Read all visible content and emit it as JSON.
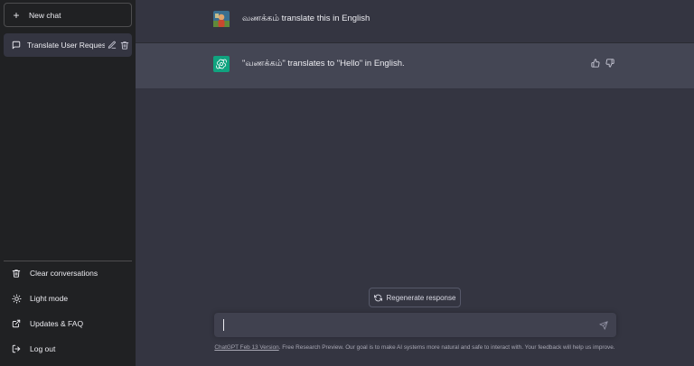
{
  "sidebar": {
    "new_chat": {
      "icon": "plus-icon",
      "label": "New chat"
    },
    "conversations": [
      {
        "title": "Translate User Request.",
        "icon": "chat-icon"
      }
    ],
    "links": [
      {
        "label": "Clear conversations",
        "icon": "trash-icon"
      },
      {
        "label": "Light mode",
        "icon": "sun-icon"
      },
      {
        "label": "Updates & FAQ",
        "icon": "external-link-icon"
      },
      {
        "label": "Log out",
        "icon": "logout-icon"
      }
    ]
  },
  "chat": {
    "user_message": "வணக்கம் translate this in English",
    "assistant_message": "\"வணக்கம்\" translates to \"Hello\" in English.",
    "regenerate_label": "Regenerate response",
    "input_value": "",
    "input_placeholder": ""
  },
  "footer": {
    "version_link": "ChatGPT Feb 13 Version",
    "text": ". Free Research Preview. Our goal is to make AI systems more natural and safe to interact with. Your feedback will help us improve."
  },
  "colors": {
    "sidebar_bg": "#202123",
    "main_bg": "#343541",
    "assistant_bg": "#444654",
    "assistant_avatar": "#10a37f",
    "input_bg": "#40414f"
  }
}
